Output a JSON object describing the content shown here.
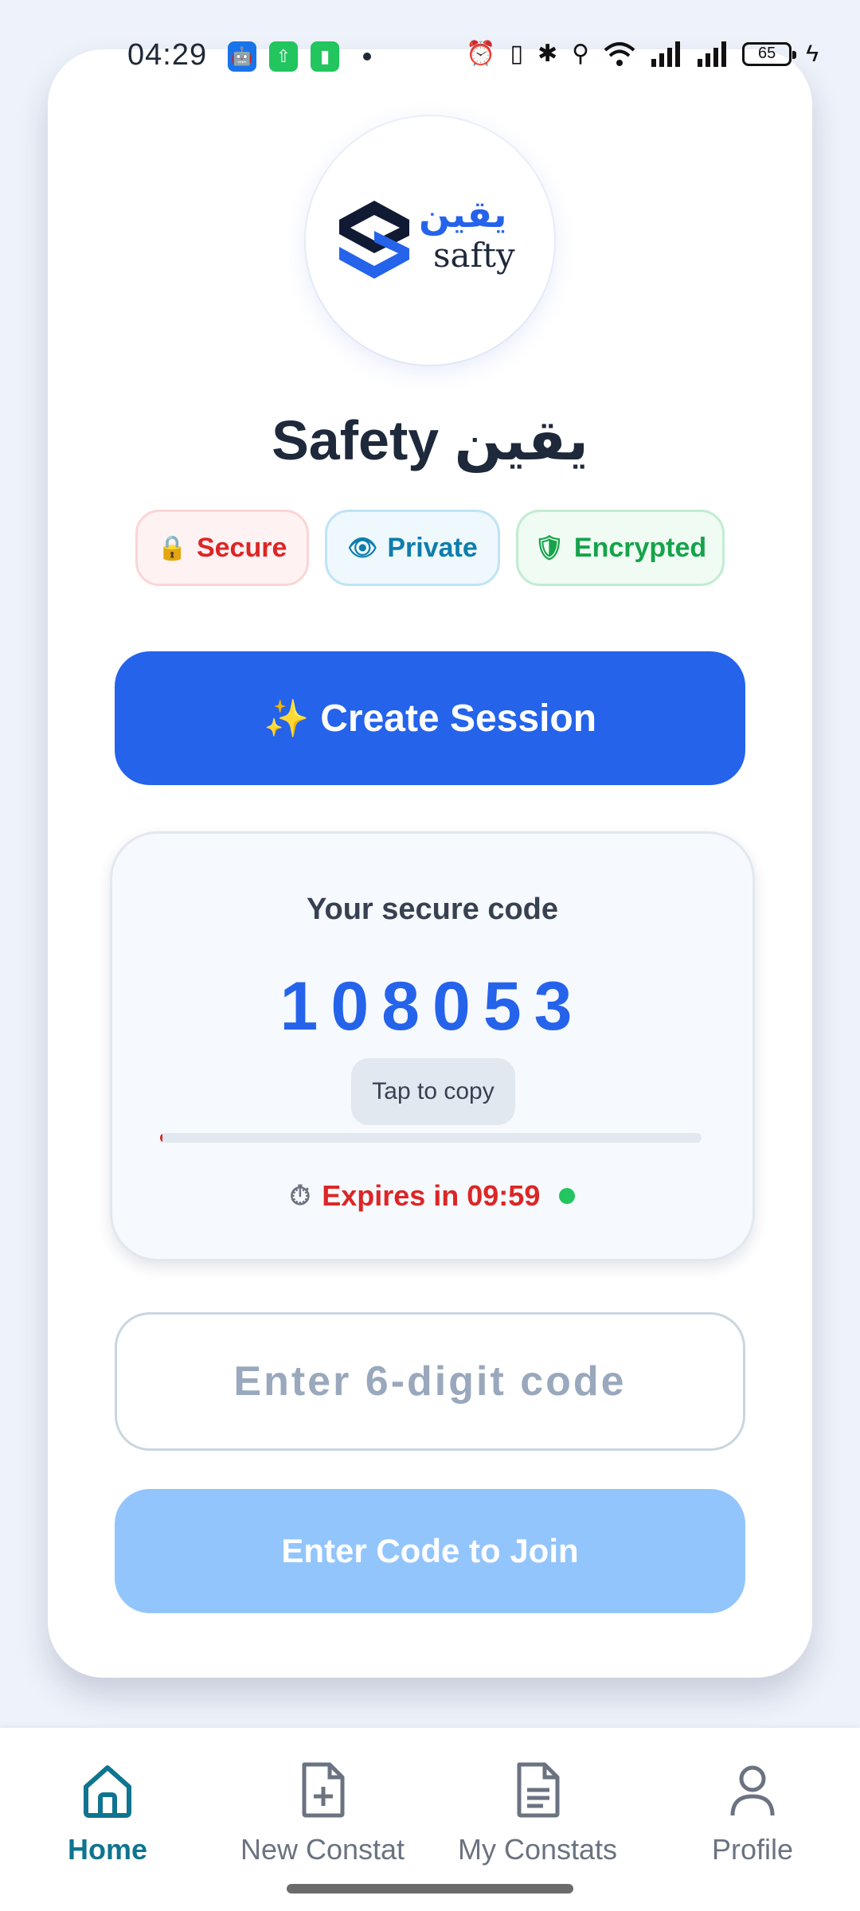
{
  "status_bar": {
    "time": "04:29",
    "battery": "65",
    "icons_left": [
      "android-icon",
      "upload-icon",
      "battery-saver-icon",
      "dot-icon"
    ],
    "icons_right": [
      "alarm-icon",
      "vibrate-icon",
      "bluetooth-icon",
      "location-icon",
      "wifi-icon",
      "signal-icon",
      "signal-icon",
      "battery-icon",
      "charging-icon"
    ]
  },
  "logo": {
    "arabic": "يقين",
    "english": "safty"
  },
  "title": "Safety يقين",
  "badges": [
    {
      "icon": "lock-icon",
      "label": "Secure"
    },
    {
      "icon": "eye-icon",
      "label": "Private"
    },
    {
      "icon": "shield-icon",
      "label": "Encrypted"
    }
  ],
  "create_button": "Create Session",
  "code_box": {
    "label": "Your secure code",
    "code": "108053",
    "copy_label": "Tap to copy",
    "expires": "Expires in 09:59",
    "progress_fraction": 0.0
  },
  "join": {
    "placeholder": "Enter 6-digit code",
    "value": "",
    "button": "Enter Code to Join"
  },
  "nav": {
    "items": [
      {
        "label": "Home",
        "icon": "home-icon",
        "active": true
      },
      {
        "label": "New Constat",
        "icon": "file-plus-icon",
        "active": false
      },
      {
        "label": "My Constats",
        "icon": "document-icon",
        "active": false
      },
      {
        "label": "Profile",
        "icon": "user-icon",
        "active": false
      }
    ]
  },
  "colors": {
    "accent": "#2563eb",
    "code": "#2563eb",
    "expires": "#dc2626",
    "join_disabled": "#93c5fd",
    "nav_active": "#0e7490"
  }
}
